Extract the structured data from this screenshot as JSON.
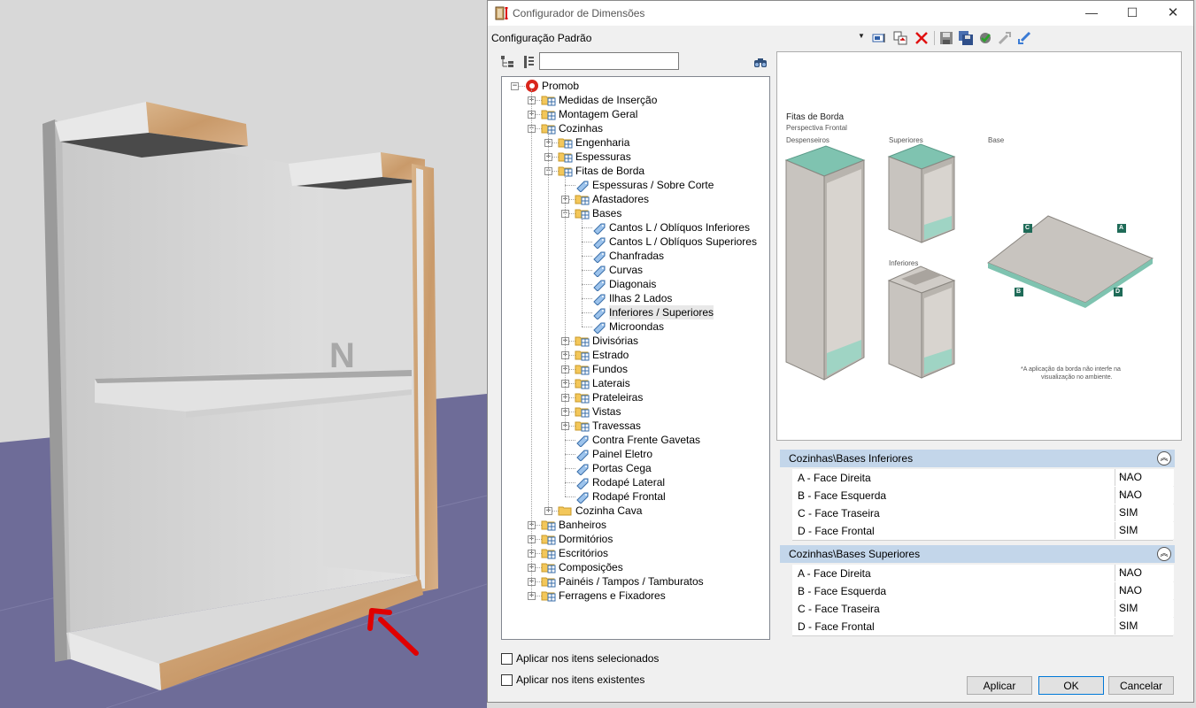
{
  "window": {
    "title": "Configurador de Dimensões",
    "min_glyph": "—",
    "max_glyph": "☐",
    "close_glyph": "✕"
  },
  "toolbar": {
    "config_label": "Configuração Padrão",
    "caret": "▼",
    "icons": [
      "rename-icon",
      "copy-config-icon",
      "delete-icon",
      "save-icon",
      "save-all-icon",
      "apply-check-icon",
      "export-icon",
      "import-icon"
    ]
  },
  "search": {
    "value": ""
  },
  "tree": {
    "rows": [
      {
        "label": "Promob",
        "level": 0,
        "exp": "−",
        "icon": "promob"
      },
      {
        "label": "Medidas de Inserção",
        "level": 1,
        "exp": "+",
        "icon": "folder"
      },
      {
        "label": "Montagem Geral",
        "level": 1,
        "exp": "+",
        "icon": "folder"
      },
      {
        "label": "Cozinhas",
        "level": 1,
        "exp": "−",
        "icon": "folder"
      },
      {
        "label": "Engenharia",
        "level": 2,
        "exp": "+",
        "icon": "folder"
      },
      {
        "label": "Espessuras",
        "level": 2,
        "exp": "+",
        "icon": "folder"
      },
      {
        "label": "Fitas de Borda",
        "level": 2,
        "exp": "−",
        "icon": "folder"
      },
      {
        "label": "Espessuras / Sobre Corte",
        "level": 3,
        "exp": "",
        "icon": "tag"
      },
      {
        "label": "Afastadores",
        "level": 3,
        "exp": "+",
        "icon": "folder"
      },
      {
        "label": "Bases",
        "level": 3,
        "exp": "−",
        "icon": "folder"
      },
      {
        "label": "Cantos L / Oblíquos Inferiores",
        "level": 4,
        "exp": "",
        "icon": "tag"
      },
      {
        "label": "Cantos L / Oblíquos Superiores",
        "level": 4,
        "exp": "",
        "icon": "tag"
      },
      {
        "label": "Chanfradas",
        "level": 4,
        "exp": "",
        "icon": "tag"
      },
      {
        "label": "Curvas",
        "level": 4,
        "exp": "",
        "icon": "tag"
      },
      {
        "label": "Diagonais",
        "level": 4,
        "exp": "",
        "icon": "tag"
      },
      {
        "label": "Ilhas 2 Lados",
        "level": 4,
        "exp": "",
        "icon": "tag"
      },
      {
        "label": "Inferiores / Superiores",
        "level": 4,
        "exp": "",
        "icon": "tag",
        "selected": true
      },
      {
        "label": "Microondas",
        "level": 4,
        "exp": "",
        "icon": "tag"
      },
      {
        "label": "Divisórias",
        "level": 3,
        "exp": "+",
        "icon": "folder"
      },
      {
        "label": "Estrado",
        "level": 3,
        "exp": "+",
        "icon": "folder"
      },
      {
        "label": "Fundos",
        "level": 3,
        "exp": "+",
        "icon": "folder"
      },
      {
        "label": "Laterais",
        "level": 3,
        "exp": "+",
        "icon": "folder"
      },
      {
        "label": "Prateleiras",
        "level": 3,
        "exp": "+",
        "icon": "folder"
      },
      {
        "label": "Vistas",
        "level": 3,
        "exp": "+",
        "icon": "folder"
      },
      {
        "label": "Travessas",
        "level": 3,
        "exp": "+",
        "icon": "folder"
      },
      {
        "label": "Contra Frente Gavetas",
        "level": 3,
        "exp": "",
        "icon": "tag"
      },
      {
        "label": "Painel Eletro",
        "level": 3,
        "exp": "",
        "icon": "tag"
      },
      {
        "label": "Portas Cega",
        "level": 3,
        "exp": "",
        "icon": "tag"
      },
      {
        "label": "Rodapé Lateral",
        "level": 3,
        "exp": "",
        "icon": "tag"
      },
      {
        "label": "Rodapé Frontal",
        "level": 3,
        "exp": "",
        "icon": "tag"
      },
      {
        "label": "Cozinha Cava",
        "level": 2,
        "exp": "+",
        "icon": "folder-plain"
      },
      {
        "label": "Banheiros",
        "level": 1,
        "exp": "+",
        "icon": "folder"
      },
      {
        "label": "Dormitórios",
        "level": 1,
        "exp": "+",
        "icon": "folder"
      },
      {
        "label": "Escritórios",
        "level": 1,
        "exp": "+",
        "icon": "folder"
      },
      {
        "label": "Composições",
        "level": 1,
        "exp": "+",
        "icon": "folder"
      },
      {
        "label": "Painéis / Tampos / Tamburatos",
        "level": 1,
        "exp": "+",
        "icon": "folder"
      },
      {
        "label": "Ferragens e Fixadores",
        "level": 1,
        "exp": "+",
        "icon": "folder"
      }
    ]
  },
  "preview": {
    "title": "Fitas de Borda",
    "subtitle": "Perspectiva Frontal",
    "col_despenseiros": "Despenseiros",
    "col_superiores": "Superiores",
    "col_base": "Base",
    "col_inferiores": "Inferiores",
    "edge_a": "A",
    "edge_b": "B",
    "edge_c": "C",
    "edge_d": "D",
    "note_line1": "*A aplicação da borda não interfe na",
    "note_line2": "visualização no ambiente.",
    "tape_color": "#7fc3b0",
    "panel_color": "#c8c4bf"
  },
  "groups": [
    {
      "header": "Cozinhas\\Bases Inferiores",
      "collapse_glyph": "︽",
      "props": [
        {
          "name": "A - Face Direita",
          "value": "NAO"
        },
        {
          "name": "B - Face Esquerda",
          "value": "NAO"
        },
        {
          "name": "C - Face Traseira",
          "value": "SIM"
        },
        {
          "name": "D - Face Frontal",
          "value": "SIM"
        }
      ]
    },
    {
      "header": "Cozinhas\\Bases Superiores",
      "collapse_glyph": "︽",
      "props": [
        {
          "name": "A - Face Direita",
          "value": "NAO"
        },
        {
          "name": "B - Face Esquerda",
          "value": "NAO"
        },
        {
          "name": "C - Face Traseira",
          "value": "SIM"
        },
        {
          "name": "D - Face Frontal",
          "value": "SIM"
        }
      ]
    }
  ],
  "dropdown_glyph": "⌵",
  "options": {
    "selected_items": "Aplicar nos itens selecionados",
    "existing_items": "Aplicar nos itens existentes"
  },
  "buttons": {
    "apply": "Aplicar",
    "ok": "OK",
    "cancel": "Cancelar"
  },
  "scene": {
    "watermark": "N"
  }
}
